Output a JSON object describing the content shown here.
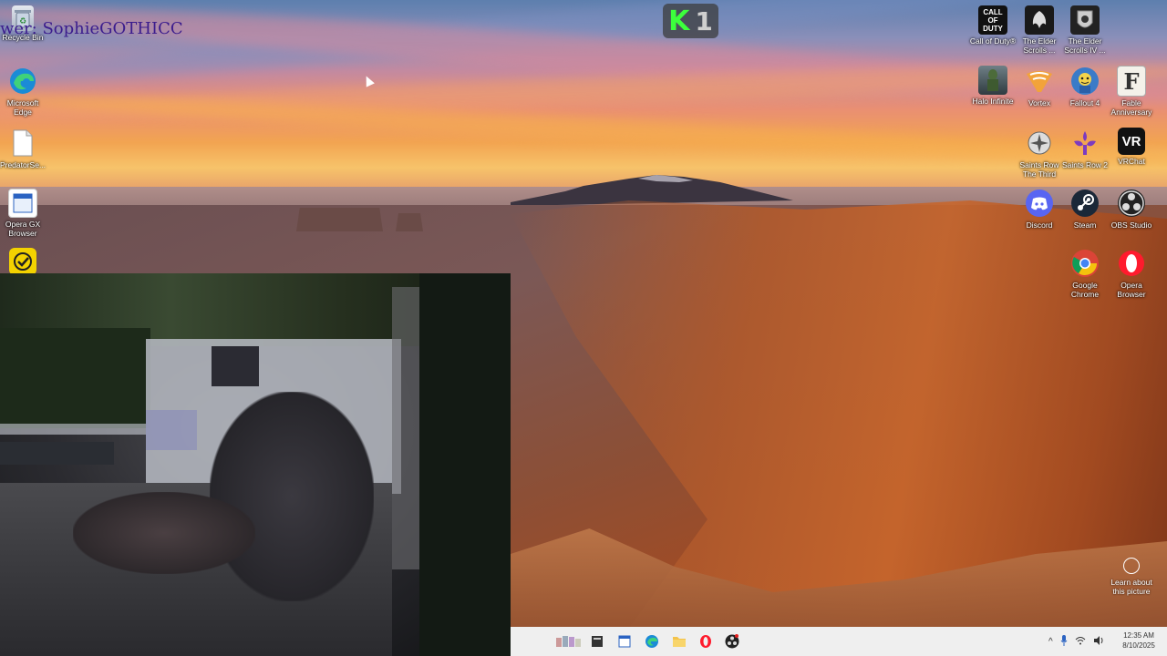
{
  "overlay": {
    "viewer_text": "wer: SophieGOTHICC",
    "counter_letter": "K",
    "counter_value": "1"
  },
  "desktop_icons_left": [
    {
      "label": "Recycle Bin",
      "icon": "recycle-bin-icon"
    },
    {
      "label": "Microsoft Edge",
      "icon": "edge-icon"
    },
    {
      "label": "PredatorSe...",
      "icon": "file-icon"
    },
    {
      "label": "Opera GX Browser",
      "icon": "opera-gx-icon"
    },
    {
      "label": "",
      "icon": "checkmark-app-icon"
    }
  ],
  "desktop_icons_right": [
    {
      "label": "Call of Duty®",
      "icon": "call-of-duty-icon",
      "art": "CALL OF DUTY"
    },
    {
      "label": "The Elder Scrolls ...",
      "icon": "elder-scrolls-icon"
    },
    {
      "label": "The Elder Scrolls IV ...",
      "icon": "elder-scrolls-iv-icon"
    },
    {
      "label": "Halo Infinite",
      "icon": "halo-icon"
    },
    {
      "label": "Vortex",
      "icon": "vortex-icon"
    },
    {
      "label": "Fallout 4",
      "icon": "fallout-icon"
    },
    {
      "label": "Fable Anniversary",
      "icon": "fable-icon",
      "art": "F"
    },
    {
      "label": "Saints Row The Third",
      "icon": "saints-row-icon"
    },
    {
      "label": "Saints Row 2",
      "icon": "saints-row-2-icon"
    },
    {
      "label": "VRChat",
      "icon": "vrchat-icon",
      "art": "VR"
    },
    {
      "label": "Discord",
      "icon": "discord-icon"
    },
    {
      "label": "Steam",
      "icon": "steam-icon"
    },
    {
      "label": "OBS Studio",
      "icon": "obs-icon"
    },
    {
      "label": "Google Chrome",
      "icon": "chrome-icon"
    },
    {
      "label": "Opera Browser",
      "icon": "opera-icon"
    }
  ],
  "learn_picture": {
    "label": "Learn about this picture"
  },
  "taskbar": {
    "apps": [
      "apps-icon",
      "terminal-icon",
      "window-icon",
      "edge-icon",
      "file-explorer-icon",
      "opera-icon",
      "obs-icon"
    ],
    "tray": [
      "chevron-up-icon",
      "microphone-icon",
      "wifi-icon",
      "speaker-icon"
    ],
    "time": "12:35 AM",
    "date": "8/10/2025"
  },
  "colors": {
    "taskbar_bg": "#efefef",
    "overlay_text": "#3b1c8d",
    "counter_k": "#3cff3c"
  }
}
